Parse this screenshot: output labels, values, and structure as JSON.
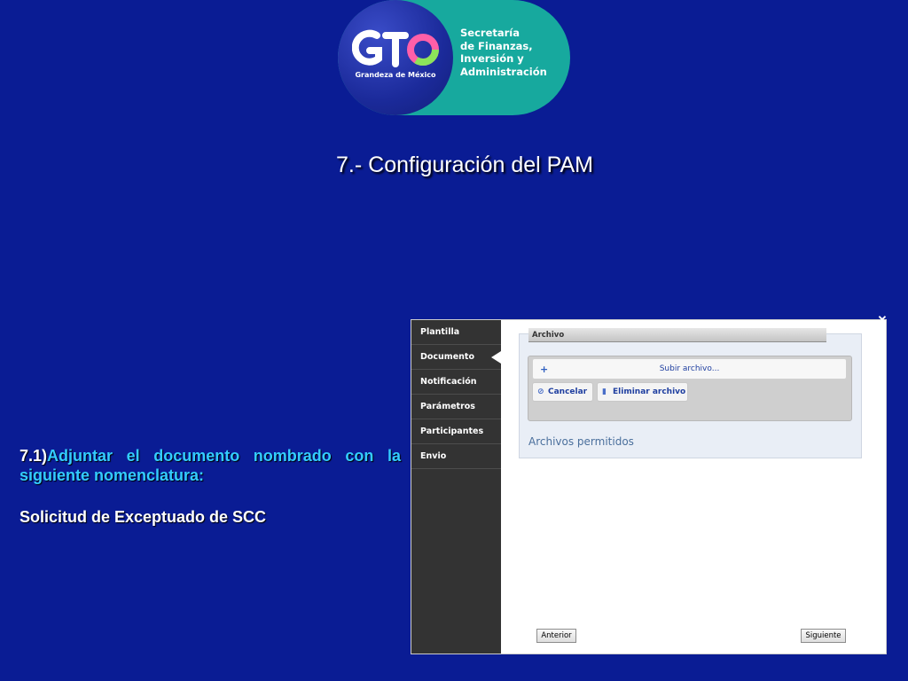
{
  "logo": {
    "mark": "GTO",
    "tagline": "Grandeza de México",
    "org_lines": [
      "Secretaría",
      "de Finanzas,",
      "Inversión y",
      "Administración"
    ],
    "colors": {
      "teal": "#17a99e",
      "blue": "#1b2a9a"
    }
  },
  "slide": {
    "title": "7.- Configuración del PAM",
    "step_number": "7.1)",
    "instruction": "Adjuntar el documento nombrado con la siguiente nomenclatura:",
    "document_name": "Solicitud de Exceptuado de SCC",
    "background_color": "#0a1c94",
    "accent_color": "#33ccff"
  },
  "screenshot": {
    "sidebar": {
      "items": [
        {
          "label": "Plantilla",
          "active": false
        },
        {
          "label": "Documento",
          "active": true
        },
        {
          "label": "Notificación",
          "active": false
        },
        {
          "label": "Parámetros",
          "active": false
        },
        {
          "label": "Participantes",
          "active": false
        },
        {
          "label": "Envio",
          "active": false
        }
      ]
    },
    "archivo": {
      "header": "Archivo",
      "upload_label": "Subir archivo...",
      "cancel_label": "Cancelar",
      "delete_label": "Eliminar archivo",
      "allowed_label": "Archivos permitidos"
    },
    "nav": {
      "prev_label": "Anterior",
      "next_label": "Siguiente"
    }
  }
}
